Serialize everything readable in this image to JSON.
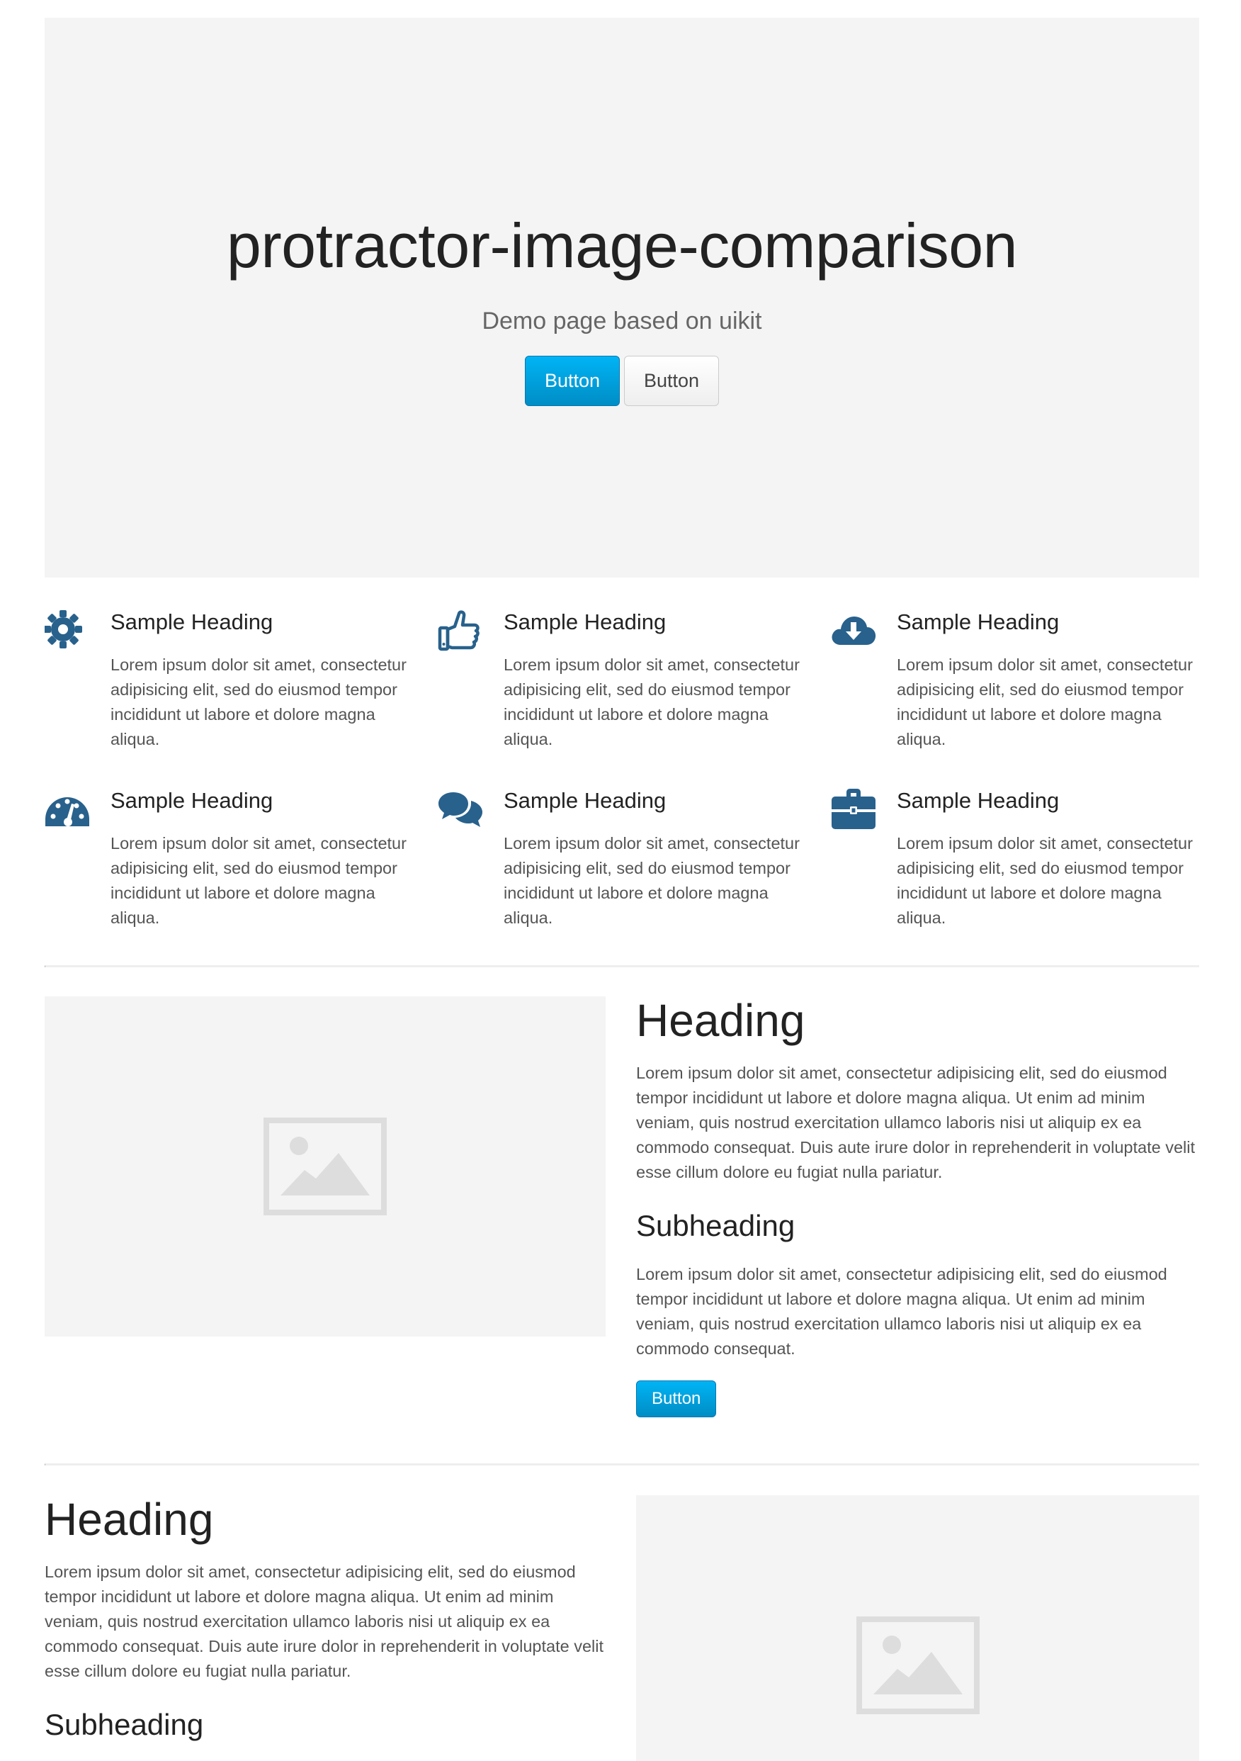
{
  "hero": {
    "title": "protractor-image-comparison",
    "subtitle": "Demo page based on uikit",
    "primary_button": "Button",
    "secondary_button": "Button"
  },
  "features": [
    {
      "icon": "gear-icon",
      "heading": "Sample Heading",
      "text": "Lorem ipsum dolor sit amet, consectetur adipisicing elit, sed do eiusmod tempor incididunt ut labore et dolore magna aliqua."
    },
    {
      "icon": "thumbs-up-icon",
      "heading": "Sample Heading",
      "text": "Lorem ipsum dolor sit amet, consectetur adipisicing elit, sed do eiusmod tempor incididunt ut labore et dolore magna aliqua."
    },
    {
      "icon": "cloud-download-icon",
      "heading": "Sample Heading",
      "text": "Lorem ipsum dolor sit amet, consectetur adipisicing elit, sed do eiusmod tempor incididunt ut labore et dolore magna aliqua."
    },
    {
      "icon": "dashboard-icon",
      "heading": "Sample Heading",
      "text": "Lorem ipsum dolor sit amet, consectetur adipisicing elit, sed do eiusmod tempor incididunt ut labore et dolore magna aliqua."
    },
    {
      "icon": "comments-icon",
      "heading": "Sample Heading",
      "text": "Lorem ipsum dolor sit amet, consectetur adipisicing elit, sed do eiusmod tempor incididunt ut labore et dolore magna aliqua."
    },
    {
      "icon": "briefcase-icon",
      "heading": "Sample Heading",
      "text": "Lorem ipsum dolor sit amet, consectetur adipisicing elit, sed do eiusmod tempor incididunt ut labore et dolore magna aliqua."
    }
  ],
  "section1": {
    "heading": "Heading",
    "text": "Lorem ipsum dolor sit amet, consectetur adipisicing elit, sed do eiusmod tempor incididunt ut labore et dolore magna aliqua. Ut enim ad minim veniam, quis nostrud exercitation ullamco laboris nisi ut aliquip ex ea commodo consequat. Duis aute irure dolor in reprehenderit in voluptate velit esse cillum dolore eu fugiat nulla pariatur.",
    "subheading": "Subheading",
    "subtext": "Lorem ipsum dolor sit amet, consectetur adipisicing elit, sed do eiusmod tempor incididunt ut labore et dolore magna aliqua. Ut enim ad minim veniam, quis nostrud exercitation ullamco laboris nisi ut aliquip ex ea commodo consequat.",
    "button": "Button"
  },
  "section2": {
    "heading": "Heading",
    "text": "Lorem ipsum dolor sit amet, consectetur adipisicing elit, sed do eiusmod tempor incididunt ut labore et dolore magna aliqua. Ut enim ad minim veniam, quis nostrud exercitation ullamco laboris nisi ut aliquip ex ea commodo consequat. Duis aute irure dolor in reprehenderit in voluptate velit esse cillum dolore eu fugiat nulla pariatur.",
    "subheading": "Subheading"
  },
  "colors": {
    "primary": "#00a8e6",
    "icon": "#28618c",
    "placeholder_bg": "#f4f4f4",
    "placeholder_icon": "#dddddd"
  }
}
